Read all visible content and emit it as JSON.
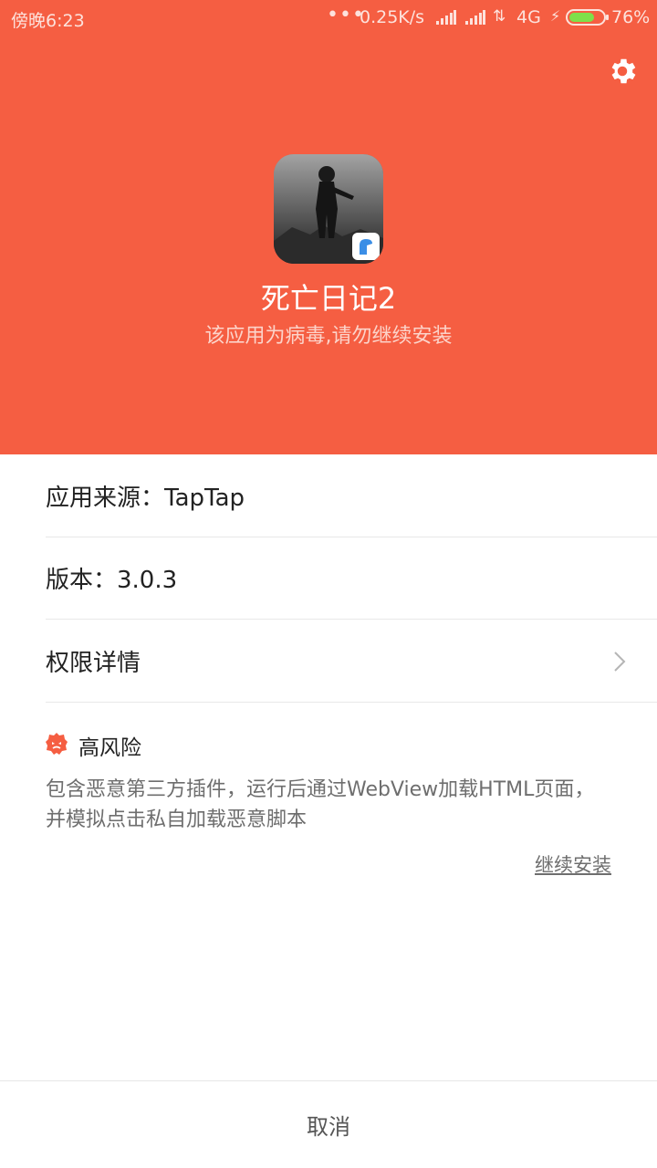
{
  "status_bar": {
    "time": "傍晚6:23",
    "dots": "•••",
    "speed": "0.25K/s",
    "network": "4G",
    "battery_pct": "76%",
    "battery_level": 0.76
  },
  "header": {
    "app_name": "死亡日记2",
    "warning": "该应用为病毒,请勿继续安装",
    "color": "#f55e42"
  },
  "info": {
    "source": "应用来源：TapTap",
    "version": "版本：3.0.3",
    "permissions": "权限详情"
  },
  "risk": {
    "title": "高风险",
    "description": "包含恶意第三方插件，运行后通过WebView加载HTML页面，并模拟点击私自加载恶意脚本",
    "continue_label": "继续安装",
    "icon_color": "#f55e42"
  },
  "footer": {
    "cancel_label": "取消"
  },
  "icons": {
    "settings": "gear-icon",
    "chevron": "chevron-right-icon",
    "risk": "warning-face-icon"
  }
}
